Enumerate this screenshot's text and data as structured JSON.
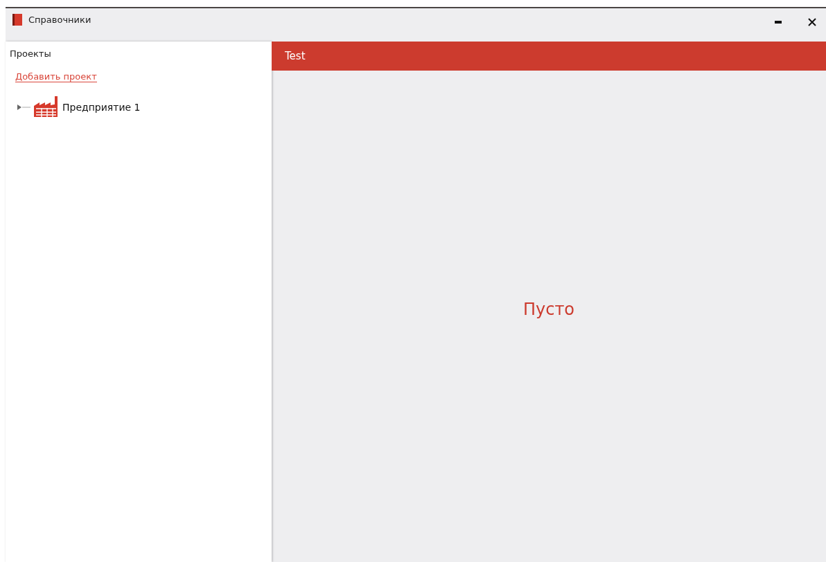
{
  "window": {
    "title": "Справочники"
  },
  "sidebar": {
    "title": "Проекты",
    "add_link": "Добавить проект",
    "tree": [
      {
        "label": "Предприятие 1",
        "expanded": false
      }
    ]
  },
  "content": {
    "tab_title": "Test",
    "empty_text": "Пусто"
  }
}
